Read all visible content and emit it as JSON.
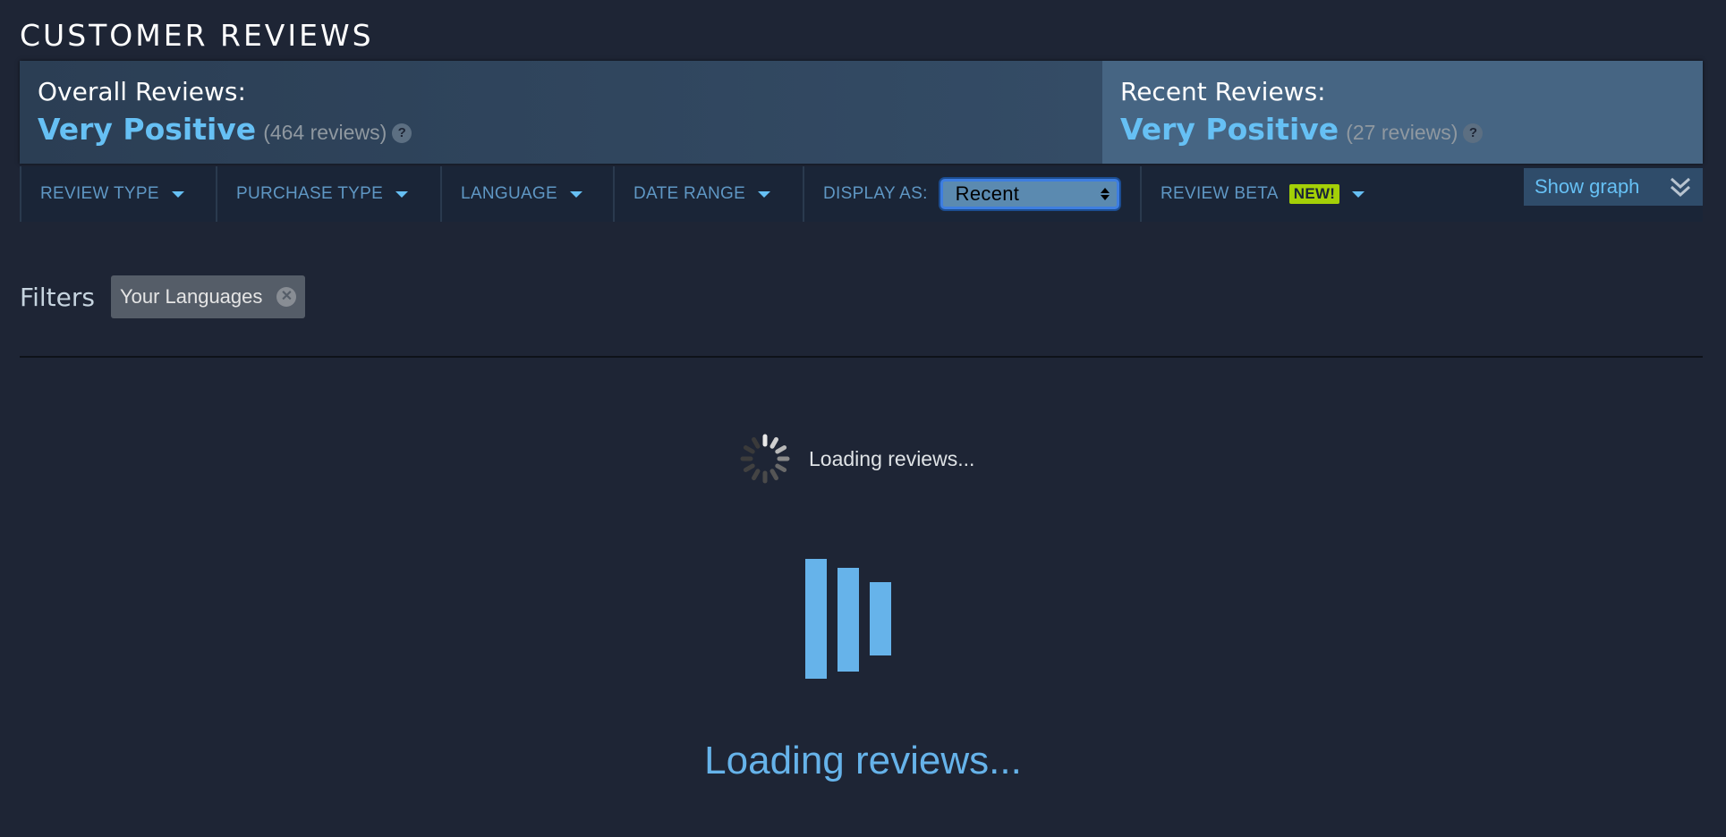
{
  "section_title": "CUSTOMER REVIEWS",
  "overall": {
    "label": "Overall Reviews:",
    "rating": "Very Positive",
    "count": "(464 reviews)",
    "help": "?"
  },
  "recent": {
    "label": "Recent Reviews:",
    "rating": "Very Positive",
    "count": "(27 reviews)",
    "help": "?"
  },
  "filterbar": {
    "review_type": "REVIEW TYPE",
    "purchase_type": "PURCHASE TYPE",
    "language": "LANGUAGE",
    "date_range": "DATE RANGE",
    "display_as_label": "DISPLAY AS:",
    "display_as_value": "Recent",
    "review_beta": "REVIEW BETA",
    "new_badge": "NEW!",
    "show_graph": "Show graph"
  },
  "filters": {
    "label": "Filters",
    "active": [
      {
        "label": "Your Languages"
      }
    ]
  },
  "loading": {
    "small_text": "Loading reviews...",
    "big_text": "Loading reviews..."
  },
  "colors": {
    "background": "#1e2535",
    "accent": "#66c0f4",
    "new_badge": "#a4d007"
  },
  "icons": [
    "help-icon",
    "dropdown-arrow-icon",
    "double-chevron-down-icon",
    "remove-filter-icon",
    "spinner-icon",
    "throbber-icon"
  ]
}
